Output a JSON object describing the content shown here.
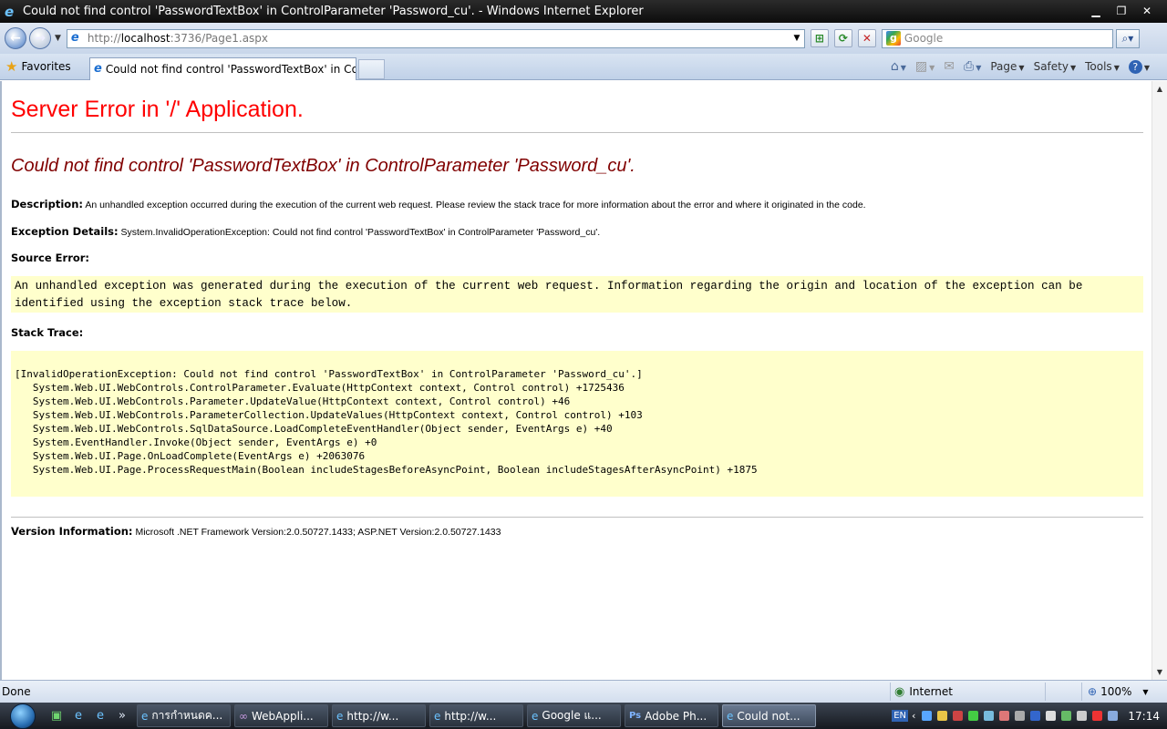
{
  "window": {
    "title": "Could not find control 'PasswordTextBox' in ControlParameter 'Password_cu'. - Windows Internet Explorer",
    "controls": [
      "minimize-icon",
      "restore-icon",
      "close-icon"
    ]
  },
  "addressbar": {
    "url_prefix": "http://",
    "url_host": "localhost",
    "url_rest": ":3736/Page1.aspx",
    "search_placeholder": "Google"
  },
  "tabs": {
    "favorites_label": "Favorites",
    "active_tab_label": "Could not find control 'PasswordTextBox' in Co..."
  },
  "commandbar": {
    "page_label": "Page",
    "safety_label": "Safety",
    "tools_label": "Tools",
    "help_label": "?"
  },
  "page": {
    "heading": "Server Error in '/' Application.",
    "error_title": "Could not find control 'PasswordTextBox' in ControlParameter 'Password_cu'.",
    "description_label": "Description:",
    "description_text": "An unhandled exception occurred during the execution of the current web request. Please review the stack trace for more information about the error and where it originated in the code.",
    "exception_label": "Exception Details:",
    "exception_text": "System.InvalidOperationException: Could not find control 'PasswordTextBox' in ControlParameter 'Password_cu'.",
    "source_label": "Source Error:",
    "source_text": "An unhandled exception was generated during the execution of the current web request. Information regarding the origin and location of the exception can be identified using the exception stack trace below.",
    "stack_label": "Stack Trace:",
    "stack_lines": [
      "[InvalidOperationException: Could not find control 'PasswordTextBox' in ControlParameter 'Password_cu'.]",
      "   System.Web.UI.WebControls.ControlParameter.Evaluate(HttpContext context, Control control) +1725436",
      "   System.Web.UI.WebControls.Parameter.UpdateValue(HttpContext context, Control control) +46",
      "   System.Web.UI.WebControls.ParameterCollection.UpdateValues(HttpContext context, Control control) +103",
      "   System.Web.UI.WebControls.SqlDataSource.LoadCompleteEventHandler(Object sender, EventArgs e) +40",
      "   System.EventHandler.Invoke(Object sender, EventArgs e) +0",
      "   System.Web.UI.Page.OnLoadComplete(EventArgs e) +2063076",
      "   System.Web.UI.Page.ProcessRequestMain(Boolean includeStagesBeforeAsyncPoint, Boolean includeStagesAfterAsyncPoint) +1875"
    ],
    "version_label": "Version Information:",
    "version_text": "Microsoft .NET Framework Version:2.0.50727.1433; ASP.NET Version:2.0.50727.1433"
  },
  "statusbar": {
    "status": "Done",
    "zone": "Internet",
    "zoom": "100%"
  },
  "taskbar": {
    "tasks": [
      {
        "label": "การกำหนดค...",
        "icon": "ie-icon",
        "active": false
      },
      {
        "label": "WebAppli...",
        "icon": "visual-studio-icon",
        "active": false
      },
      {
        "label": "http://w...",
        "icon": "ie-icon",
        "active": false
      },
      {
        "label": "http://w...",
        "icon": "ie-icon",
        "active": false
      },
      {
        "label": "Google แ...",
        "icon": "ie-icon",
        "active": false
      },
      {
        "label": "Adobe Ph...",
        "icon": "photoshop-icon",
        "active": false
      },
      {
        "label": "Could not...",
        "icon": "ie-icon",
        "active": true
      }
    ],
    "language": "EN",
    "clock": "17:14"
  },
  "colors": {
    "heading_red": "#ff0000",
    "error_title_maroon": "#800000",
    "code_box_bg": "#ffffcc"
  }
}
